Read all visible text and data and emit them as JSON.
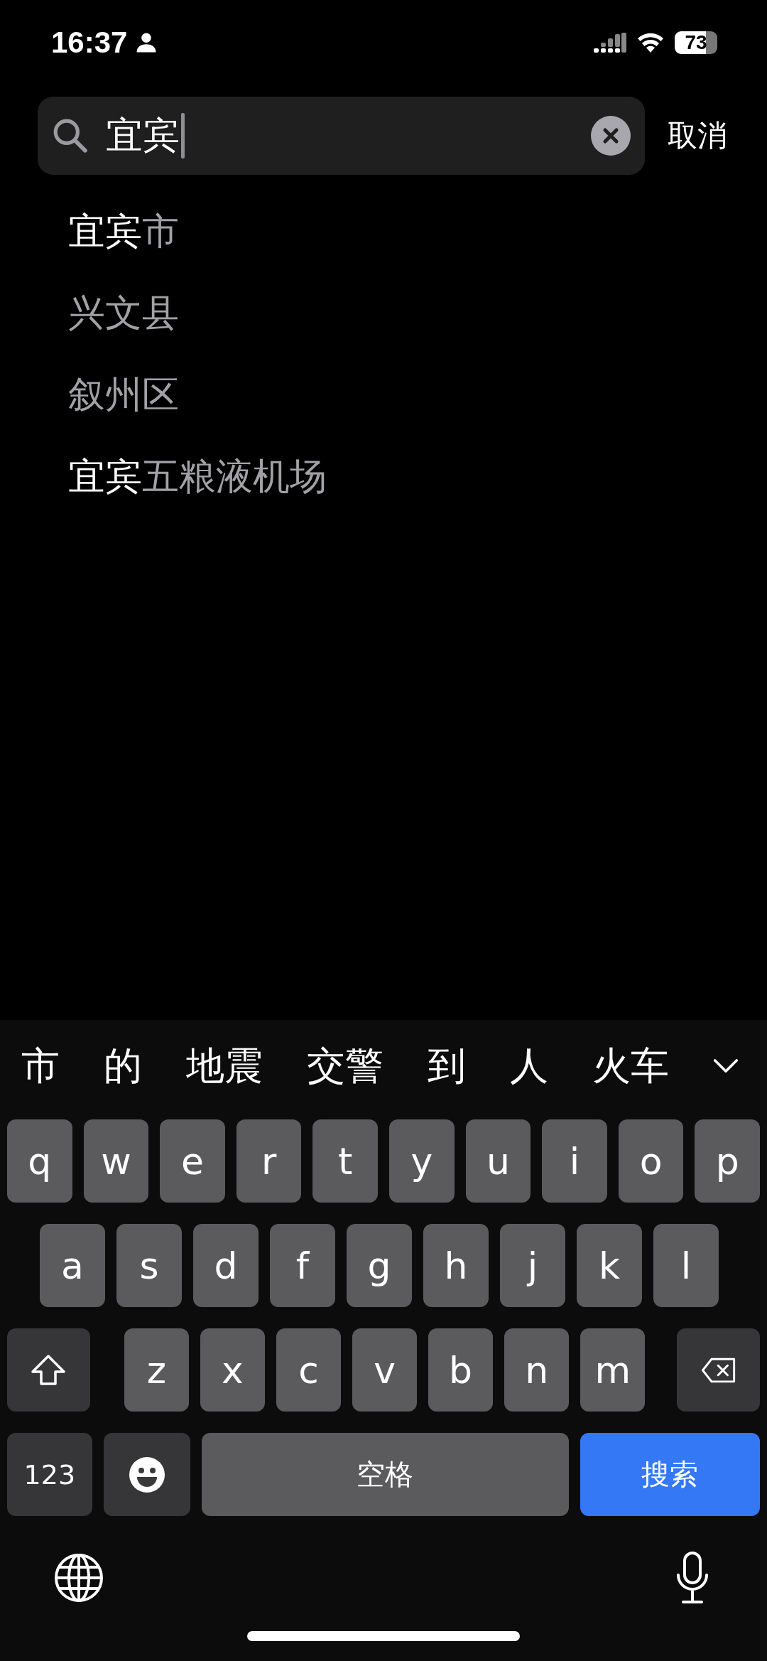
{
  "status_bar": {
    "time": "16:37",
    "battery": "73"
  },
  "search": {
    "value": "宜宾",
    "cancel": "取消"
  },
  "results": [
    {
      "matched": "宜宾",
      "rest": "市"
    },
    {
      "rest": "兴文县"
    },
    {
      "rest": "叙州区"
    },
    {
      "matched": "宜宾",
      "rest": "五粮液机场"
    }
  ],
  "keyboard": {
    "candidates": [
      "市",
      "的",
      "地震",
      "交警",
      "到",
      "人",
      "火车"
    ],
    "key_rows": [
      {
        "keys": [
          {
            "kind": "letter",
            "label": "q"
          },
          {
            "kind": "letter",
            "label": "w"
          },
          {
            "kind": "letter",
            "label": "e"
          },
          {
            "kind": "letter",
            "label": "r"
          },
          {
            "kind": "letter",
            "label": "t"
          },
          {
            "kind": "letter",
            "label": "y"
          },
          {
            "kind": "letter",
            "label": "u"
          },
          {
            "kind": "letter",
            "label": "i"
          },
          {
            "kind": "letter",
            "label": "o"
          },
          {
            "kind": "letter",
            "label": "p"
          }
        ]
      },
      {
        "keys": [
          {
            "kind": "letter",
            "label": "a"
          },
          {
            "kind": "letter",
            "label": "s"
          },
          {
            "kind": "letter",
            "label": "d"
          },
          {
            "kind": "letter",
            "label": "f"
          },
          {
            "kind": "letter",
            "label": "g"
          },
          {
            "kind": "letter",
            "label": "h"
          },
          {
            "kind": "letter",
            "label": "j"
          },
          {
            "kind": "letter",
            "label": "k"
          },
          {
            "kind": "letter",
            "label": "l"
          }
        ]
      },
      {
        "keys": [
          {
            "kind": "shift"
          },
          {
            "kind": "letter",
            "label": "z"
          },
          {
            "kind": "letter",
            "label": "x"
          },
          {
            "kind": "letter",
            "label": "c"
          },
          {
            "kind": "letter",
            "label": "v"
          },
          {
            "kind": "letter",
            "label": "b"
          },
          {
            "kind": "letter",
            "label": "n"
          },
          {
            "kind": "letter",
            "label": "m"
          },
          {
            "kind": "delete"
          }
        ]
      },
      {
        "keys": [
          {
            "kind": "numbers",
            "label": "123"
          },
          {
            "kind": "emoji"
          },
          {
            "kind": "space",
            "label": "空格"
          },
          {
            "kind": "search",
            "label": "搜索"
          }
        ]
      }
    ]
  }
}
